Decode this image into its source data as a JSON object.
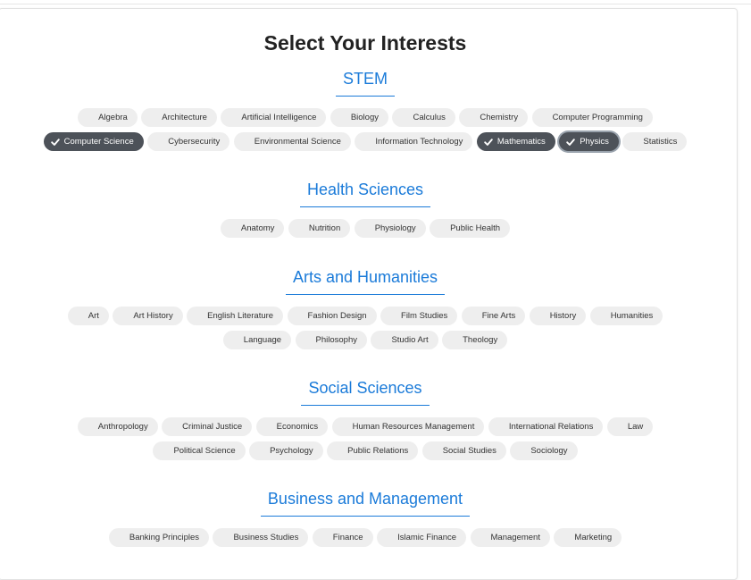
{
  "page": {
    "title": "Select Your Interests"
  },
  "sections": [
    {
      "title": "STEM",
      "items": [
        {
          "label": "Algebra",
          "selected": false
        },
        {
          "label": "Architecture",
          "selected": false
        },
        {
          "label": "Artificial Intelligence",
          "selected": false
        },
        {
          "label": "Biology",
          "selected": false
        },
        {
          "label": "Calculus",
          "selected": false
        },
        {
          "label": "Chemistry",
          "selected": false
        },
        {
          "label": "Computer Programming",
          "selected": false
        },
        {
          "label": "Computer Science",
          "selected": true
        },
        {
          "label": "Cybersecurity",
          "selected": false
        },
        {
          "label": "Environmental Science",
          "selected": false
        },
        {
          "label": "Information Technology",
          "selected": false
        },
        {
          "label": "Mathematics",
          "selected": true
        },
        {
          "label": "Physics",
          "selected": true,
          "focused": true
        },
        {
          "label": "Statistics",
          "selected": false
        }
      ]
    },
    {
      "title": "Health Sciences",
      "items": [
        {
          "label": "Anatomy",
          "selected": false
        },
        {
          "label": "Nutrition",
          "selected": false
        },
        {
          "label": "Physiology",
          "selected": false
        },
        {
          "label": "Public Health",
          "selected": false
        }
      ]
    },
    {
      "title": "Arts and Humanities",
      "items": [
        {
          "label": "Art",
          "selected": false
        },
        {
          "label": "Art History",
          "selected": false
        },
        {
          "label": "English Literature",
          "selected": false
        },
        {
          "label": "Fashion Design",
          "selected": false
        },
        {
          "label": "Film Studies",
          "selected": false
        },
        {
          "label": "Fine Arts",
          "selected": false
        },
        {
          "label": "History",
          "selected": false
        },
        {
          "label": "Humanities",
          "selected": false
        },
        {
          "label": "Language",
          "selected": false
        },
        {
          "label": "Philosophy",
          "selected": false
        },
        {
          "label": "Studio Art",
          "selected": false
        },
        {
          "label": "Theology",
          "selected": false
        }
      ]
    },
    {
      "title": "Social Sciences",
      "items": [
        {
          "label": "Anthropology",
          "selected": false
        },
        {
          "label": "Criminal Justice",
          "selected": false
        },
        {
          "label": "Economics",
          "selected": false
        },
        {
          "label": "Human Resources Management",
          "selected": false
        },
        {
          "label": "International Relations",
          "selected": false
        },
        {
          "label": "Law",
          "selected": false
        },
        {
          "label": "Political Science",
          "selected": false
        },
        {
          "label": "Psychology",
          "selected": false
        },
        {
          "label": "Public Relations",
          "selected": false
        },
        {
          "label": "Social Studies",
          "selected": false
        },
        {
          "label": "Sociology",
          "selected": false
        }
      ]
    },
    {
      "title": "Business and Management",
      "items": [
        {
          "label": "Banking Principles",
          "selected": false
        },
        {
          "label": "Business Studies",
          "selected": false
        },
        {
          "label": "Finance",
          "selected": false
        },
        {
          "label": "Islamic Finance",
          "selected": false
        },
        {
          "label": "Management",
          "selected": false
        },
        {
          "label": "Marketing",
          "selected": false
        }
      ]
    }
  ],
  "icons": {
    "selected_chip_icon": "check-icon"
  },
  "colors": {
    "section_title": "#1b7bd9",
    "chip_background": "#eeeeee",
    "chip_selected_background": "#4d5259",
    "chip_selected_text": "#ffffff"
  }
}
